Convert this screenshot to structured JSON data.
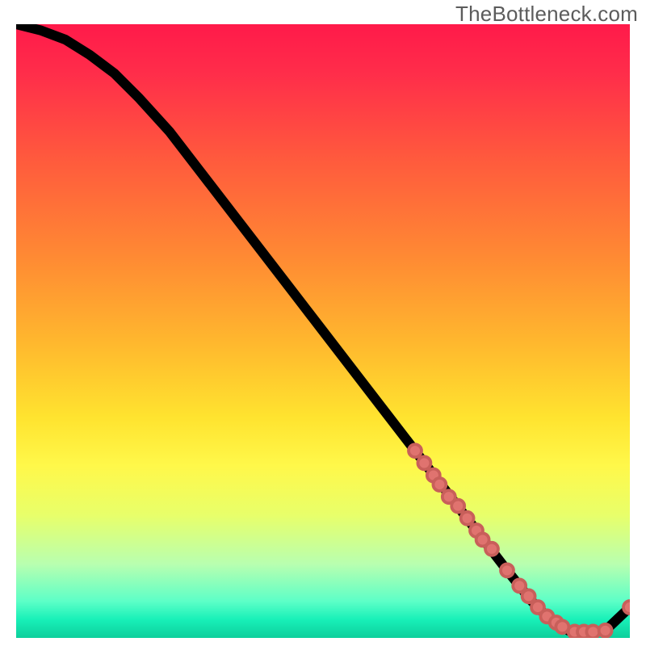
{
  "watermark": "TheBottleneck.com",
  "chart_data": {
    "type": "line",
    "title": "",
    "xlabel": "",
    "ylabel": "",
    "xlim": [
      0,
      100
    ],
    "ylim": [
      0,
      100
    ],
    "grid": false,
    "background_gradient": {
      "top": "#ff1a4a",
      "middle": "#ffe32f",
      "bottom": "#0dcf9c"
    },
    "series": [
      {
        "name": "bottleneck-curve",
        "x": [
          0,
          4,
          8,
          12,
          16,
          20,
          25,
          30,
          35,
          40,
          45,
          50,
          55,
          60,
          65,
          70,
          75,
          80,
          84,
          87,
          90,
          93,
          96,
          100
        ],
        "y": [
          100,
          99,
          97.5,
          95,
          92,
          88,
          82.5,
          76,
          69.5,
          63,
          56.5,
          50,
          43.5,
          37,
          30.5,
          24,
          17.5,
          11,
          6,
          3,
          1.2,
          1,
          1.2,
          5
        ],
        "color": "#000000"
      }
    ],
    "scatter_points": {
      "name": "highlighted-points",
      "color": "#e0736f",
      "points": [
        {
          "x": 65,
          "y": 30.5
        },
        {
          "x": 66.5,
          "y": 28.5
        },
        {
          "x": 68,
          "y": 26.5
        },
        {
          "x": 69,
          "y": 25
        },
        {
          "x": 70.5,
          "y": 23
        },
        {
          "x": 72,
          "y": 21.5
        },
        {
          "x": 73.5,
          "y": 19.5
        },
        {
          "x": 75,
          "y": 17.5
        },
        {
          "x": 76,
          "y": 16
        },
        {
          "x": 77.5,
          "y": 14.5
        },
        {
          "x": 80,
          "y": 11
        },
        {
          "x": 82,
          "y": 8.5
        },
        {
          "x": 83.5,
          "y": 6.8
        },
        {
          "x": 85,
          "y": 5
        },
        {
          "x": 86.5,
          "y": 3.5
        },
        {
          "x": 88,
          "y": 2.5
        },
        {
          "x": 89,
          "y": 1.8
        },
        {
          "x": 91,
          "y": 1
        },
        {
          "x": 92.5,
          "y": 1
        },
        {
          "x": 94,
          "y": 1
        },
        {
          "x": 96,
          "y": 1.2
        },
        {
          "x": 100,
          "y": 5
        }
      ]
    }
  }
}
